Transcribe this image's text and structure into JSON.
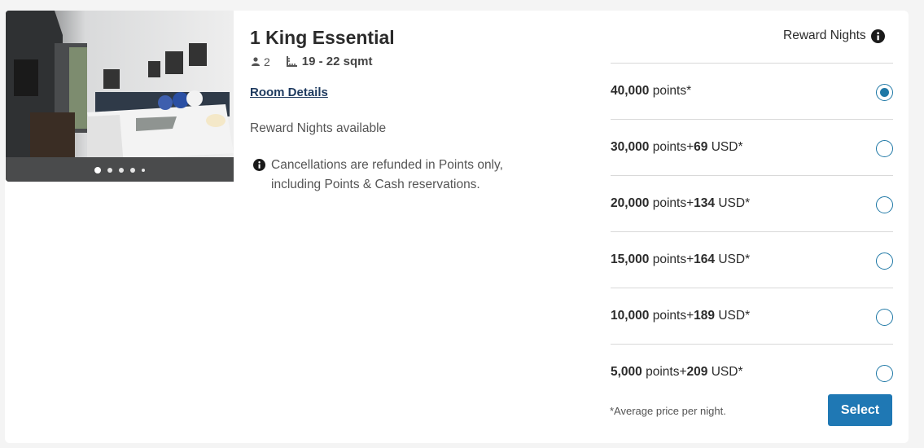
{
  "room": {
    "title": "1 King Essential",
    "guests": "2",
    "size": "19 - 22 sqmt",
    "details_link": "Room Details",
    "availability": "Reward Nights available",
    "cancellation_line1": "Cancellations are refunded in Points only,",
    "cancellation_line2": "including Points & Cash reservations."
  },
  "gallery": {
    "total_slides": 5,
    "active_slide": 1
  },
  "rewards": {
    "heading": "Reward Nights",
    "options": [
      {
        "points": "40,000",
        "points_word": "points*",
        "plus": "",
        "cash": "",
        "currency": "",
        "selected": true
      },
      {
        "points": "30,000",
        "points_word": "points",
        "plus": "+",
        "cash": "69",
        "currency": "USD*",
        "selected": false
      },
      {
        "points": "20,000",
        "points_word": "points",
        "plus": "+",
        "cash": "134",
        "currency": "USD*",
        "selected": false
      },
      {
        "points": "15,000",
        "points_word": "points",
        "plus": "+",
        "cash": "164",
        "currency": "USD*",
        "selected": false
      },
      {
        "points": "10,000",
        "points_word": "points",
        "plus": "+",
        "cash": "189",
        "currency": "USD*",
        "selected": false
      },
      {
        "points": "5,000",
        "points_word": "points",
        "plus": "+",
        "cash": "209",
        "currency": "USD*",
        "selected": false
      }
    ],
    "footnote": "*Average price per night.",
    "select_label": "Select"
  },
  "colors": {
    "accent": "#1f78b4",
    "link": "#1e3a5f"
  }
}
